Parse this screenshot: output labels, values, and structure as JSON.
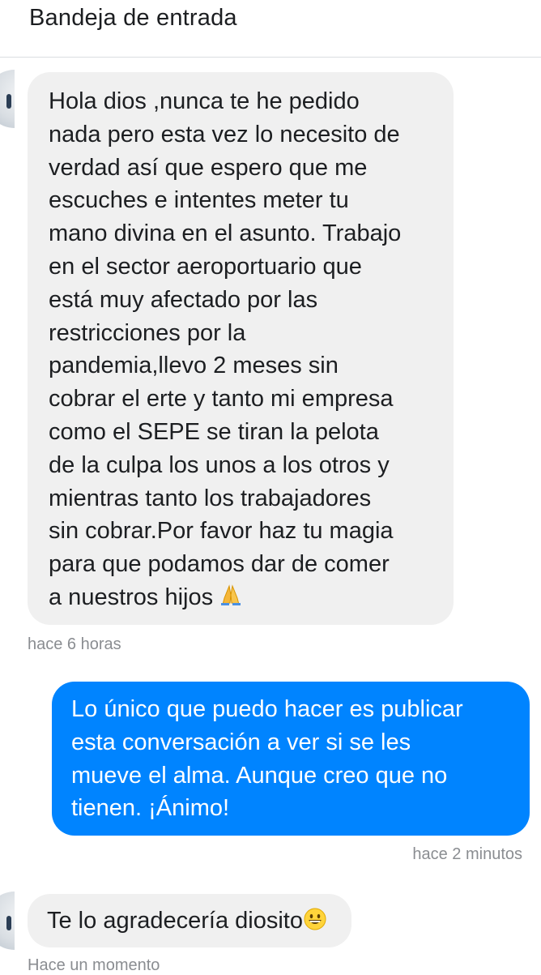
{
  "header": {
    "title": "Bandeja de entrada"
  },
  "messages": [
    {
      "direction": "incoming",
      "text": "Hola dios ,nunca te he pedido\nnada pero esta vez lo necesito de\nverdad así que espero que me\nescuches e intentes meter tu\nmano divina en el asunto. Trabajo\nen el sector aeroportuario que\nestá muy afectado por las\nrestricciones por la\npandemia,llevo 2 meses sin\ncobrar el erte y tanto mi empresa\ncomo el SEPE se tiran la pelota\nde la culpa los unos a los otros y\nmientras tanto los trabajadores\nsin cobrar.Por favor haz tu magia\npara que podamos dar de comer\na nuestros hijos",
      "emoji": "folded-hands-emoji",
      "timestamp": "hace 6 horas"
    },
    {
      "direction": "outgoing",
      "text": "Lo único que puedo hacer es publicar\nesta conversación a ver si se les\nmueve el alma. Aunque creo que no\ntienen. ¡Ánimo!",
      "timestamp": "hace 2 minutos"
    },
    {
      "direction": "incoming",
      "text": "Te lo agradecería diosito",
      "emoji": "grinning-face-emoji",
      "timestamp": "Hace un momento"
    }
  ],
  "colors": {
    "incoming_bubble": "#f0f0f0",
    "outgoing_bubble": "#0084ff",
    "timestamp": "#8a8d91"
  }
}
